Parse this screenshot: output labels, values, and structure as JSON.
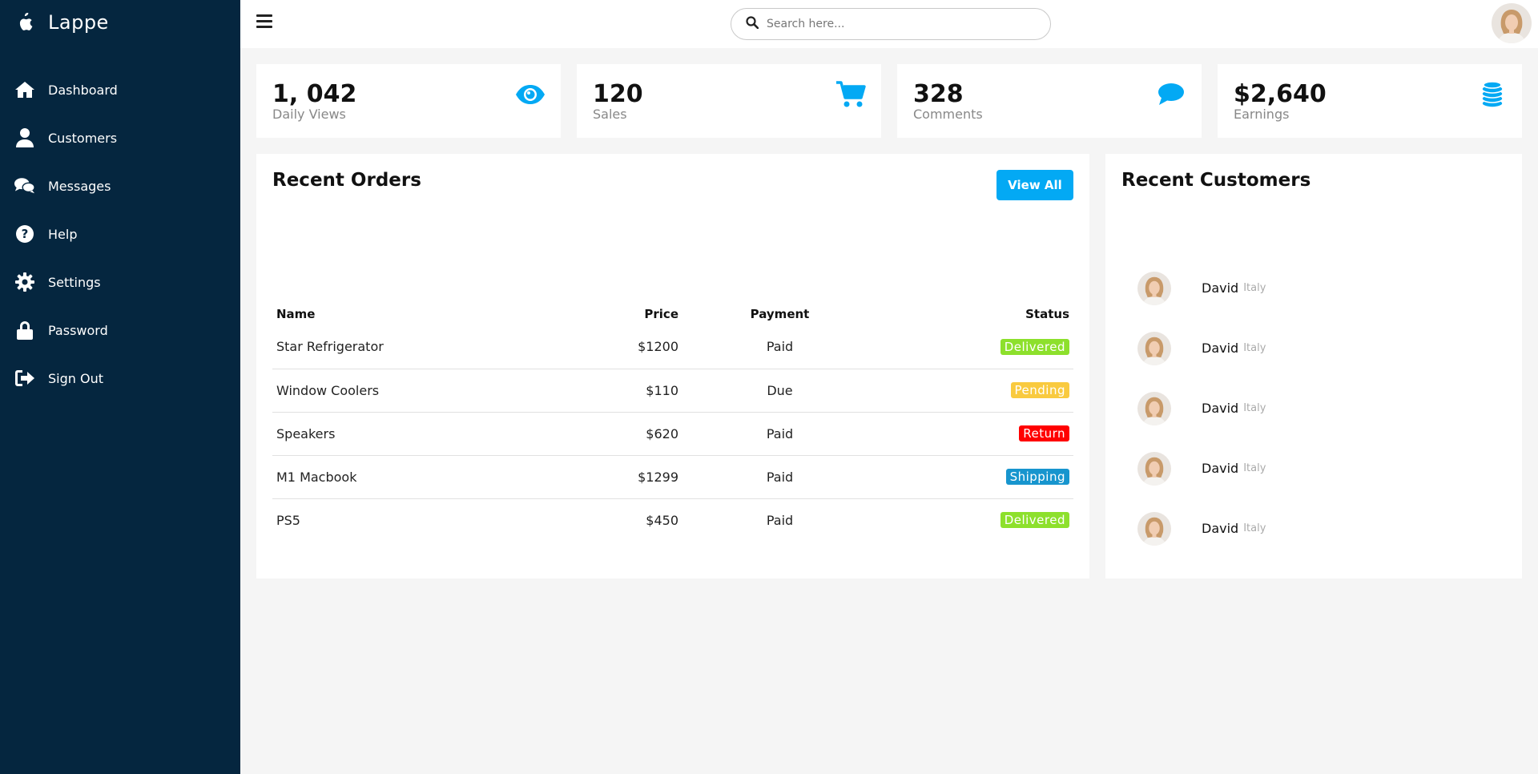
{
  "brand": {
    "title": "Lappe",
    "icon": "apple-icon"
  },
  "sidebar": {
    "items": [
      {
        "label": "Dashboard",
        "icon": "home-icon"
      },
      {
        "label": "Customers",
        "icon": "user-icon"
      },
      {
        "label": "Messages",
        "icon": "chat-icon"
      },
      {
        "label": "Help",
        "icon": "help-icon"
      },
      {
        "label": "Settings",
        "icon": "gear-icon"
      },
      {
        "label": "Password",
        "icon": "lock-icon"
      },
      {
        "label": "Sign Out",
        "icon": "sign-out-icon"
      }
    ]
  },
  "topbar": {
    "search_placeholder": "Search here..."
  },
  "cards": [
    {
      "number": "1, 042",
      "label": "Daily Views",
      "icon": "eye-icon"
    },
    {
      "number": "120",
      "label": "Sales",
      "icon": "cart-icon"
    },
    {
      "number": "328",
      "label": "Comments",
      "icon": "comment-icon"
    },
    {
      "number": "$2,640",
      "label": "Earnings",
      "icon": "coins-icon"
    }
  ],
  "orders": {
    "title": "Recent Orders",
    "view_all": "View All",
    "columns": [
      "Name",
      "Price",
      "Payment",
      "Status"
    ],
    "rows": [
      {
        "name": "Star Refrigerator",
        "price": "$1200",
        "payment": "Paid",
        "status": "Delivered"
      },
      {
        "name": "Window Coolers",
        "price": "$110",
        "payment": "Due",
        "status": "Pending"
      },
      {
        "name": "Speakers",
        "price": "$620",
        "payment": "Paid",
        "status": "Return"
      },
      {
        "name": "M1 Macbook",
        "price": "$1299",
        "payment": "Paid",
        "status": "Shipping"
      },
      {
        "name": "PS5",
        "price": "$450",
        "payment": "Paid",
        "status": "Delivered"
      }
    ]
  },
  "customers": {
    "title": "Recent Customers",
    "list": [
      {
        "name": "David",
        "country": "Italy"
      },
      {
        "name": "David",
        "country": "Italy"
      },
      {
        "name": "David",
        "country": "Italy"
      },
      {
        "name": "David",
        "country": "Italy"
      },
      {
        "name": "David",
        "country": "Italy"
      }
    ]
  },
  "colors": {
    "sidebar_bg": "#05263f",
    "accent": "#03a9f4",
    "delivered": "#8de02c",
    "pending": "#f9ca3f",
    "return": "#f00",
    "shipping": "#1795ce"
  }
}
